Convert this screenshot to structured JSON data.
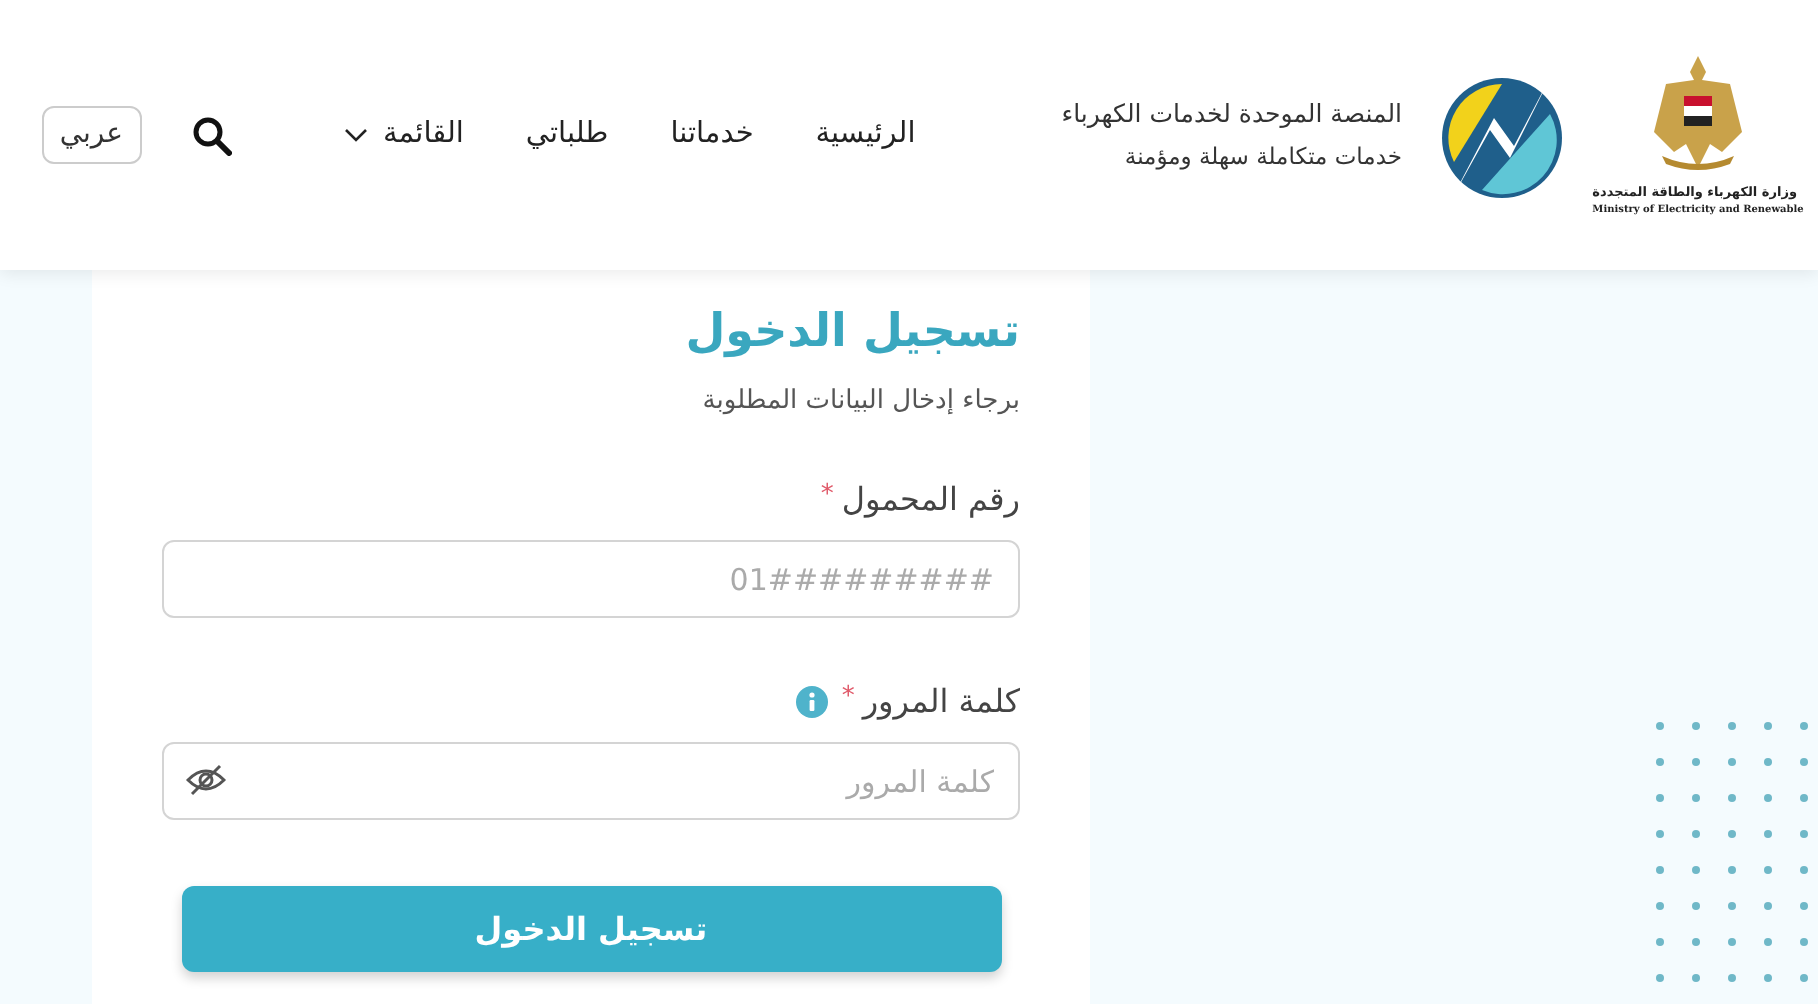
{
  "header": {
    "ministry_logo": {
      "name_ar": "وزارة الكهرباء والطاقة المتجددة",
      "name_en": "Ministry of Electricity and Renewable"
    },
    "platform": {
      "title": "المنصة الموحدة لخدمات الكهرباء",
      "tagline": "خدمات متكاملة سهلة ومؤمنة"
    },
    "nav": [
      {
        "label": "الرئيسية",
        "kind": "link"
      },
      {
        "label": "خدماتنا",
        "kind": "link"
      },
      {
        "label": "طلباتي",
        "kind": "link"
      },
      {
        "label": "القائمة",
        "kind": "dropdown"
      }
    ],
    "language_button": "عربي"
  },
  "login": {
    "title": "تسجيل الدخول",
    "subtitle": "برجاء إدخال البيانات المطلوبة",
    "fields": [
      {
        "label": "رقم المحمول",
        "required_mark": "*",
        "info": false,
        "kind": "text",
        "placeholder": "01#########"
      },
      {
        "label": "كلمة المرور",
        "required_mark": "*",
        "info": true,
        "kind": "password",
        "placeholder": "كلمة المرور"
      }
    ],
    "submit": "تسجيل الدخول"
  }
}
